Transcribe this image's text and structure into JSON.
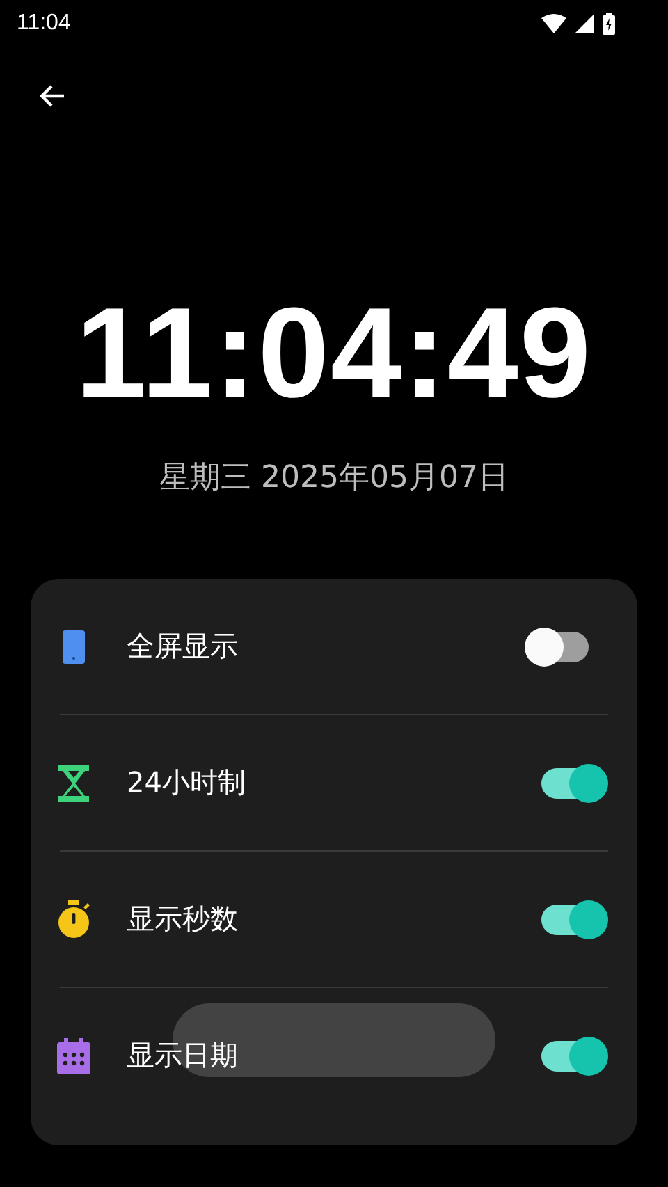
{
  "status_bar": {
    "time": "11:04"
  },
  "clock": {
    "time": "11:04:49",
    "date": "星期三 2025年05月07日"
  },
  "settings": [
    {
      "kind": "phone",
      "label": "全屏显示",
      "on": false
    },
    {
      "kind": "hourglass",
      "label": "24小时制",
      "on": true
    },
    {
      "kind": "stopwatch",
      "label": "显示秒数",
      "on": true
    },
    {
      "kind": "calendar",
      "label": "显示日期",
      "on": true
    }
  ],
  "toast": {
    "kind": "blank"
  }
}
